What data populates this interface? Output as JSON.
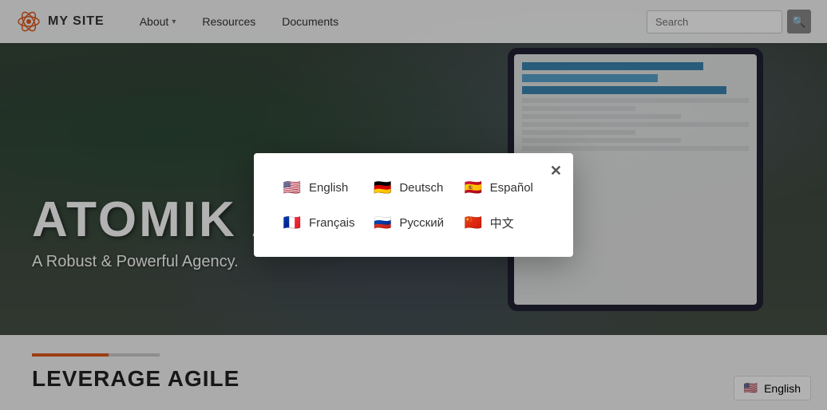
{
  "header": {
    "logo_text": "MY SITE",
    "nav": [
      {
        "label": "About",
        "has_dropdown": true
      },
      {
        "label": "Resources",
        "has_dropdown": false
      },
      {
        "label": "Documents",
        "has_dropdown": false
      }
    ],
    "search_placeholder": "Search",
    "search_icon": "🔍"
  },
  "hero": {
    "title": "ATOMIK AGENCY",
    "subtitle": "A Robust & Powerful Agency."
  },
  "below_hero": {
    "title": "LEVERAGE AGILE"
  },
  "language_modal": {
    "languages": [
      {
        "code": "en",
        "label": "English",
        "flag_emoji": "🇺🇸"
      },
      {
        "code": "de",
        "label": "Deutsch",
        "flag_emoji": "🇩🇪"
      },
      {
        "code": "es",
        "label": "Español",
        "flag_emoji": "🇪🇸"
      },
      {
        "code": "fr",
        "label": "Français",
        "flag_emoji": "🇫🇷"
      },
      {
        "code": "ru",
        "label": "Русский",
        "flag_emoji": "🇷🇺"
      },
      {
        "code": "zh",
        "label": "中文",
        "flag_emoji": "🇨🇳"
      }
    ],
    "close_label": "✕"
  },
  "footer_lang": {
    "label": "English",
    "flag_emoji": "🇺🇸"
  }
}
